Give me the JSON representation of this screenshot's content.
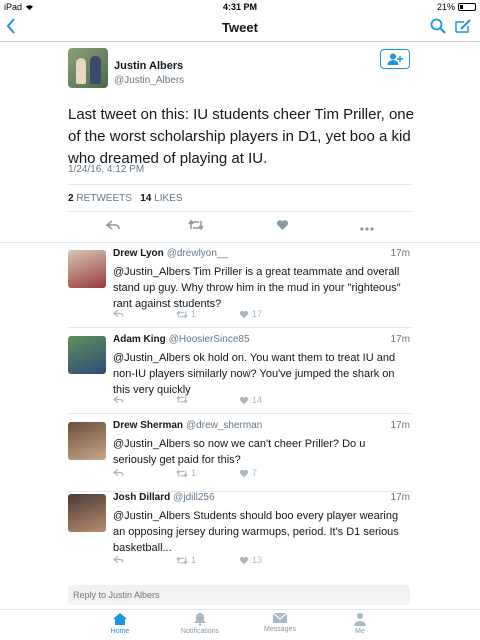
{
  "status_bar": {
    "device": "iPad",
    "time": "4:31 PM",
    "battery": "21%"
  },
  "nav": {
    "title": "Tweet"
  },
  "main_tweet": {
    "author_name": "Justin Albers",
    "author_handle": "@Justin_Albers",
    "text": "Last tweet on this: IU students cheer Tim Priller, one of the worst scholarship players in D1, yet boo a kid who dreamed of playing at IU.",
    "timestamp": "1/24/16, 4:12 PM",
    "retweets_count": "2",
    "retweets_label": "RETWEETS",
    "likes_count": "14",
    "likes_label": "LIKES"
  },
  "replies": [
    {
      "name": "Drew Lyon",
      "handle": "@drewlyon__",
      "time": "17m",
      "text": "@Justin_Albers Tim Priller is a great teammate and overall stand up guy. Why throw him in the mud in your \"righteous\" rant against students?",
      "retweets": "1",
      "likes": "17"
    },
    {
      "name": "Adam King",
      "handle": "@HoosierSince85",
      "time": "17m",
      "text": "@Justin_Albers ok hold on. You want them to treat IU and non-IU players similarly now? You've jumped the shark on this very quickly",
      "retweets": "",
      "likes": "14"
    },
    {
      "name": "Drew Sherman",
      "handle": "@drew_sherman",
      "time": "17m",
      "text": "@Justin_Albers so now we can't cheer Priller? Do u seriously get paid for this?",
      "retweets": "1",
      "likes": "7"
    },
    {
      "name": "Josh Dillard",
      "handle": "@jdill256",
      "time": "17m",
      "text": "@Justin_Albers Students should boo every player wearing an opposing jersey during warmups, period. It's D1  serious basketball...",
      "retweets": "1",
      "likes": "13"
    }
  ],
  "reply_bar": {
    "placeholder": "Reply to Justin Albers"
  },
  "tabs": [
    {
      "label": "Home",
      "icon": "home-icon"
    },
    {
      "label": "Notifications",
      "icon": "bell-icon"
    },
    {
      "label": "Messages",
      "icon": "envelope-icon"
    },
    {
      "label": "Me",
      "icon": "person-icon"
    }
  ],
  "colors": {
    "accent": "#1b95e0",
    "muted": "#657786",
    "divider": "#e1e8ed"
  }
}
